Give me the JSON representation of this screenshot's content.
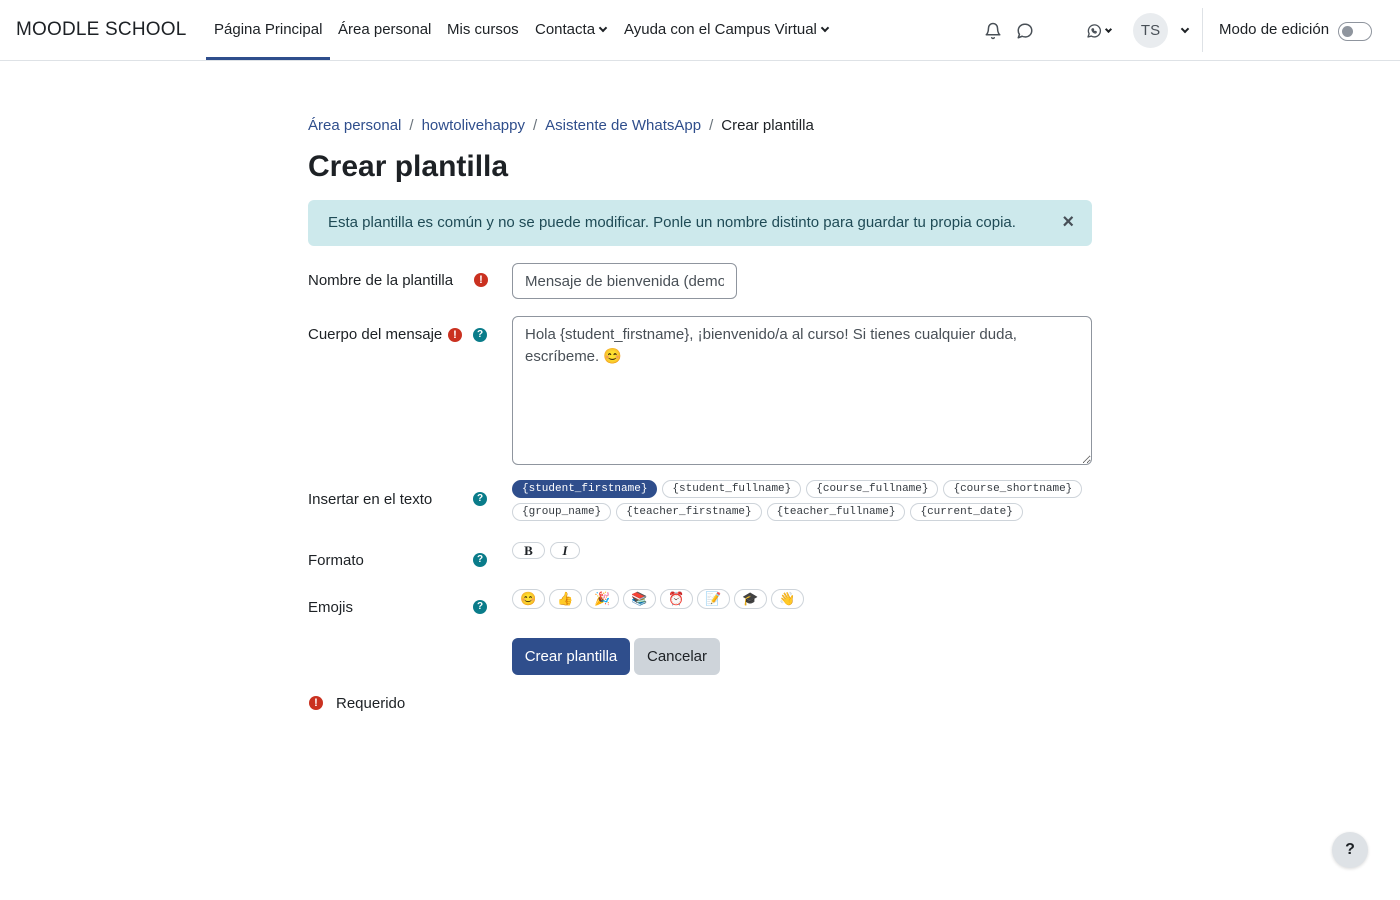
{
  "navbar": {
    "brand": "MOODLE SCHOOL",
    "items": [
      {
        "label": "Página Principal",
        "active": true
      },
      {
        "label": "Área personal"
      },
      {
        "label": "Mis cursos"
      },
      {
        "label": "Contacta"
      },
      {
        "label": "Ayuda con el Campus Virtual"
      }
    ],
    "avatar_initials": "TS",
    "edit_mode_label": "Modo de edición",
    "icons": [
      "bell-icon",
      "chat-bubble-icon",
      "whatsapp-icon",
      "chevron-down-icon"
    ]
  },
  "breadcrumb": [
    {
      "label": "Área personal"
    },
    {
      "label": "howtolivehappy"
    },
    {
      "label": "Asistente de WhatsApp"
    },
    {
      "label": "Crear plantilla"
    }
  ],
  "page_title": "Crear plantilla",
  "alert": {
    "text": "Esta plantilla es común y no se puede modificar. Ponle un nombre distinto para guardar tu propia copia.",
    "close": "×"
  },
  "form": {
    "name_label": "Nombre de la plantilla",
    "name_value": "Mensaje de bienvenida (demo)",
    "body_label": "Cuerpo del mensaje",
    "body_value": "Hola {student_firstname}, ¡bienvenido/a al curso! Si tienes cualquier duda, escríbeme. 😊",
    "insert_label": "Insertar en el texto",
    "placeholders": [
      "{student_firstname}",
      "{student_fullname}",
      "{course_fullname}",
      "{course_shortname}",
      "{group_name}",
      "{teacher_firstname}",
      "{teacher_fullname}",
      "{current_date}"
    ],
    "format_label": "Formato",
    "format_bold": "B",
    "format_italic": "I",
    "emojis_label": "Emojis",
    "emojis": [
      "😊",
      "👍",
      "🎉",
      "📚",
      "⏰",
      "📝",
      "🎓",
      "👋"
    ],
    "submit_label": "Crear plantilla",
    "cancel_label": "Cancelar",
    "required_label": "Requerido"
  },
  "help_button": "?",
  "colors": {
    "primary": "#2f4e8c",
    "alert_bg": "#cde9ec",
    "required": "#ca3120",
    "help": "#0a7c8a"
  }
}
